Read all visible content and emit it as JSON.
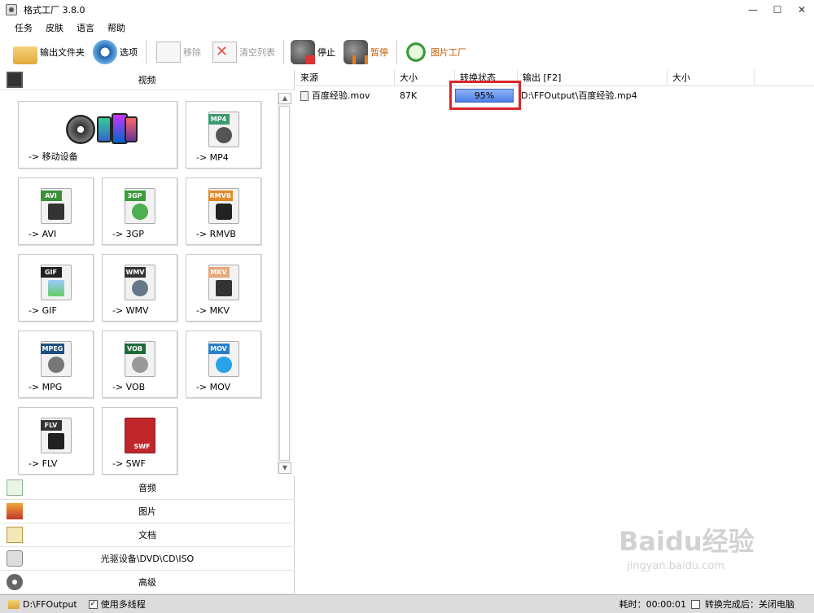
{
  "window": {
    "title": "格式工厂 3.8.0",
    "controls": [
      "—",
      "☐",
      "✕"
    ]
  },
  "menu": [
    "任务",
    "皮肤",
    "语言",
    "帮助"
  ],
  "toolbar": {
    "output_folder": "输出文件夹",
    "options": "选项",
    "remove": "移除",
    "clear_list": "清空列表",
    "stop": "停止",
    "pause": "暂停",
    "picture_factory": "图片工厂"
  },
  "categories": {
    "video": "视频",
    "audio": "音频",
    "image": "图片",
    "document": "文档",
    "disc": "光驱设备\\DVD\\CD\\ISO",
    "advanced": "高级"
  },
  "tiles": {
    "mobile": {
      "label": "-> 移动设备"
    },
    "mp4": {
      "label": "-> MP4",
      "tag": "MP4"
    },
    "avi": {
      "label": "-> AVI",
      "tag": "AVI"
    },
    "3gp": {
      "label": "-> 3GP",
      "tag": "3GP"
    },
    "rmvb": {
      "label": "-> RMVB",
      "tag": "RMVB"
    },
    "gif": {
      "label": "-> GIF",
      "tag": "GIF"
    },
    "wmv": {
      "label": "-> WMV",
      "tag": "WMV"
    },
    "mkv": {
      "label": "-> MKV",
      "tag": "MKV"
    },
    "mpg": {
      "label": "-> MPG",
      "tag": "MPEG"
    },
    "vob": {
      "label": "-> VOB",
      "tag": "VOB"
    },
    "mov": {
      "label": "-> MOV",
      "tag": "MOV"
    },
    "flv": {
      "label": "-> FLV",
      "tag": "FLV"
    },
    "swf": {
      "label": "-> SWF",
      "tag": "SWF"
    }
  },
  "table": {
    "headers": [
      "来源",
      "大小",
      "转换状态",
      "输出 [F2]",
      "大小"
    ],
    "rows": [
      {
        "source": "百度经验.mov",
        "size": "87K",
        "status": "95%",
        "output": "D:\\FFOutput\\百度经验.mp4",
        "out_size": ""
      }
    ]
  },
  "statusbar": {
    "folder": "D:\\FFOutput",
    "multithread": "使用多线程",
    "elapsed": "耗时：00:00:01",
    "after_done": "转换完成后：关闭电脑"
  },
  "watermark": {
    "main": "Baidu经验",
    "sub": "jingyan.baidu.com"
  },
  "colors": {
    "progress": "#4f7fe6",
    "highlight": "#d8262b",
    "statusbar": "#dcdcdc"
  }
}
